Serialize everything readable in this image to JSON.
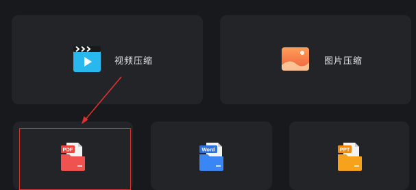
{
  "cards": {
    "video": {
      "label": "视频压缩",
      "icon": "video-clapper-icon"
    },
    "image": {
      "label": "图片压缩",
      "icon": "landscape-image-icon"
    },
    "pdf": {
      "badge": "PDF",
      "icon": "pdf-folder-icon"
    },
    "word": {
      "badge": "Word",
      "icon": "word-folder-icon"
    },
    "ppt": {
      "badge": "PPT",
      "icon": "ppt-folder-icon"
    }
  },
  "annotation": {
    "color": "#e0322c",
    "target": "pdf"
  },
  "colors": {
    "background": "#18191c",
    "card": "#232428",
    "pdf": "#f0534f",
    "word": "#3a86f5",
    "ppt": "#f6a21d"
  }
}
